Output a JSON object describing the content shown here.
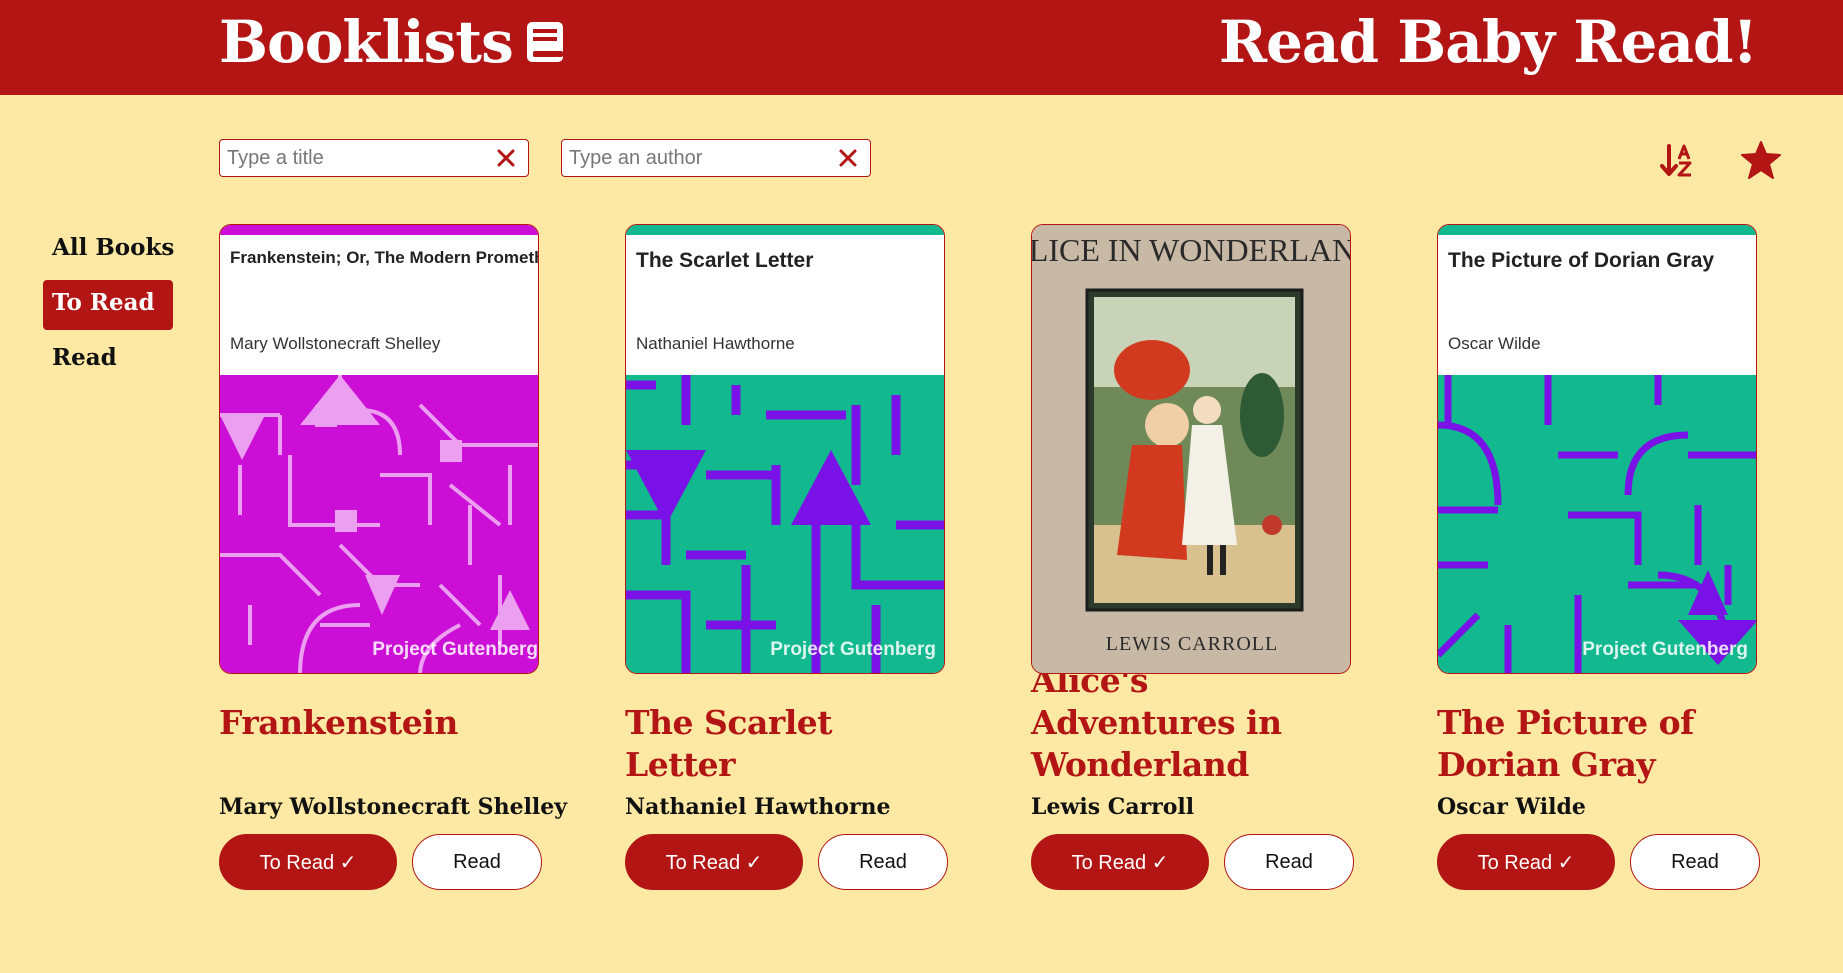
{
  "header": {
    "brand": "Booklists",
    "tagline": "Read Baby Read!"
  },
  "search": {
    "title_placeholder": "Type a title",
    "author_placeholder": "Type an author"
  },
  "nav": {
    "items": [
      {
        "label": "All Books"
      },
      {
        "label": "To Read"
      },
      {
        "label": "Read"
      }
    ],
    "active": "To Read"
  },
  "buttons": {
    "to_read": "To Read ✓",
    "read": "Read"
  },
  "books": [
    {
      "title": "Frankenstein",
      "author": "Mary Wollstonecraft Shelley",
      "cover_title": "Frankenstein; Or, The Modern Prometheus",
      "cover_author": "Mary Wollstonecraft Shelley",
      "cover_publisher": "Project Gutenberg",
      "cover_color": "#cc0fd6"
    },
    {
      "title": "The Scarlet Letter",
      "author": "Nathaniel Hawthorne",
      "cover_title": "The Scarlet Letter",
      "cover_author": "Nathaniel Hawthorne",
      "cover_publisher": "Project Gutenberg",
      "cover_color": "#12b98f"
    },
    {
      "title": "Alice's Adventures in Wonderland",
      "author": "Lewis Carroll",
      "cover_title": "ALICE IN WONDERLAND",
      "cover_author": "LEWIS CARROLL"
    },
    {
      "title": "The Picture of Dorian Gray",
      "author": "Oscar Wilde",
      "cover_title": "The Picture of Dorian Gray",
      "cover_author": "Oscar Wilde",
      "cover_publisher": "Project Gutenberg",
      "cover_color": "#12b98f"
    }
  ],
  "colors": {
    "primary": "#b31515",
    "background": "#fde9a3",
    "accent_violet": "#7a11e6"
  }
}
